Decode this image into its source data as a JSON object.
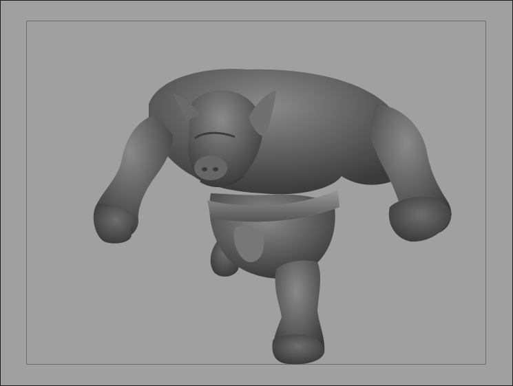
{
  "viewport": {
    "background": "#a0a0a0",
    "border_color": "#1a1a1a",
    "gate_color": "#6a6a6a",
    "model_color": "#5a5a5a",
    "subject": "pig-orc-sculpt"
  }
}
